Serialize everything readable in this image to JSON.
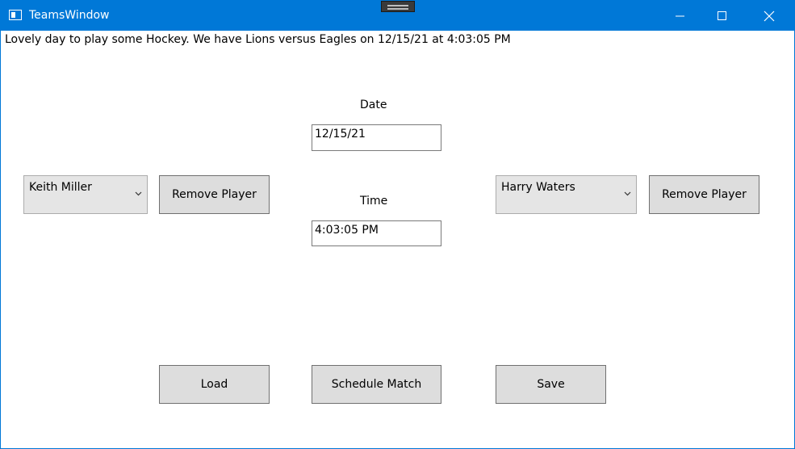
{
  "window": {
    "title": "TeamsWindow",
    "accent_color": "#0078d7",
    "controls": [
      "minimize-icon",
      "maximize-icon",
      "close-icon"
    ]
  },
  "main": {
    "message": "Lovely day to play some Hockey. We have Lions versus Eagles on 12/15/21 at 4:03:05 PM",
    "date_label": "Date",
    "date_value": "12/15/21",
    "time_label": "Time",
    "time_value": "4:03:05 PM"
  },
  "left_team": {
    "selected_player": "Keith Miller",
    "remove_label": "Remove Player"
  },
  "right_team": {
    "selected_player": "Harry Waters",
    "remove_label": "Remove Player"
  },
  "actions": {
    "load_label": "Load",
    "schedule_label": "Schedule Match",
    "save_label": "Save"
  }
}
